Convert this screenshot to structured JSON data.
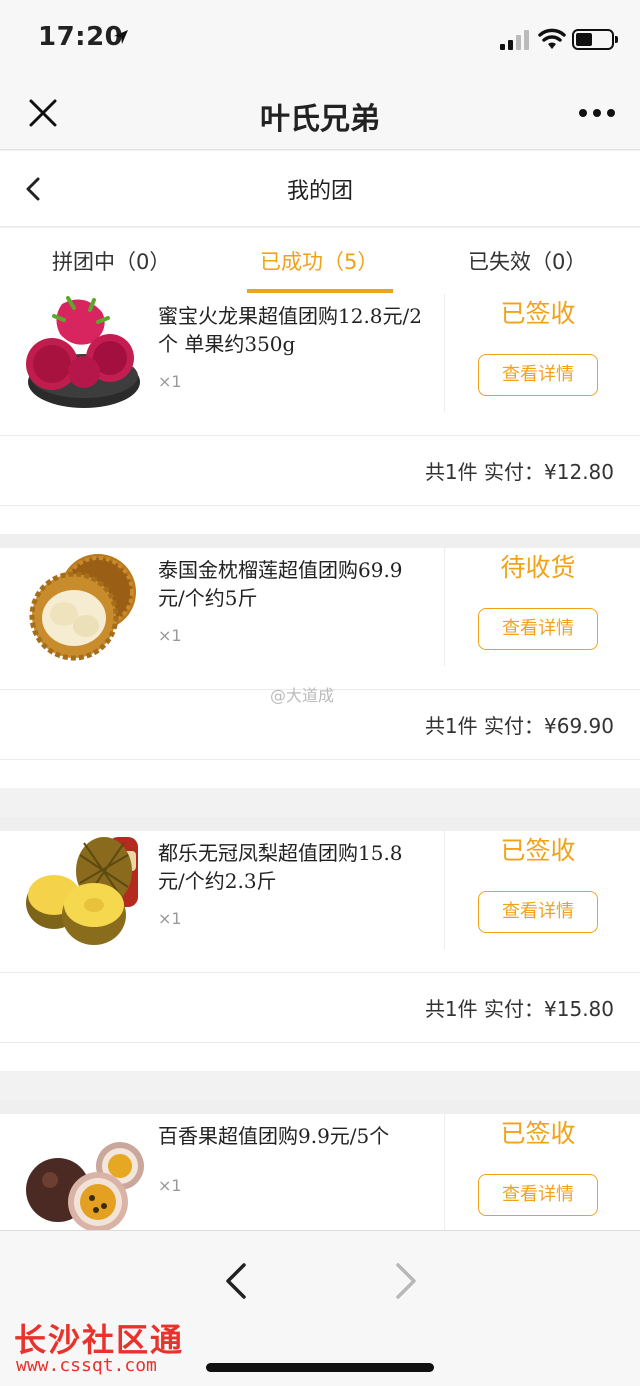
{
  "status_bar": {
    "time": "17:20"
  },
  "nav": {
    "title": "叶氏兄弟"
  },
  "sub_header": {
    "title": "我的团"
  },
  "tabs": [
    {
      "label": "拼团中（0）"
    },
    {
      "label": "已成功（5）"
    },
    {
      "label": "已失效（0）"
    }
  ],
  "orders": [
    {
      "title": "蜜宝火龙果超值团购12.8元/2个 单果约350g",
      "qty": "×1",
      "status": "已签收",
      "button": "查看详情",
      "total": "共1件 实付：¥12.80"
    },
    {
      "title": "泰国金枕榴莲超值团购69.9元/个约5斤",
      "qty": "×1",
      "status": "待收货",
      "button": "查看详情",
      "total": "共1件 实付：¥69.90"
    },
    {
      "title": "都乐无冠凤梨超值团购15.8元/个约2.3斤",
      "qty": "×1",
      "status": "已签收",
      "button": "查看详情",
      "total": "共1件 实付：¥15.80"
    },
    {
      "title": "百香果超值团购9.9元/5个",
      "qty": "×1",
      "status": "已签收",
      "button": "查看详情"
    }
  ],
  "watermark": "@大道成",
  "footer": {
    "logo": "长沙社区通",
    "url": "www.cssqt.com"
  },
  "colors": {
    "accent": "#f0a21a"
  }
}
